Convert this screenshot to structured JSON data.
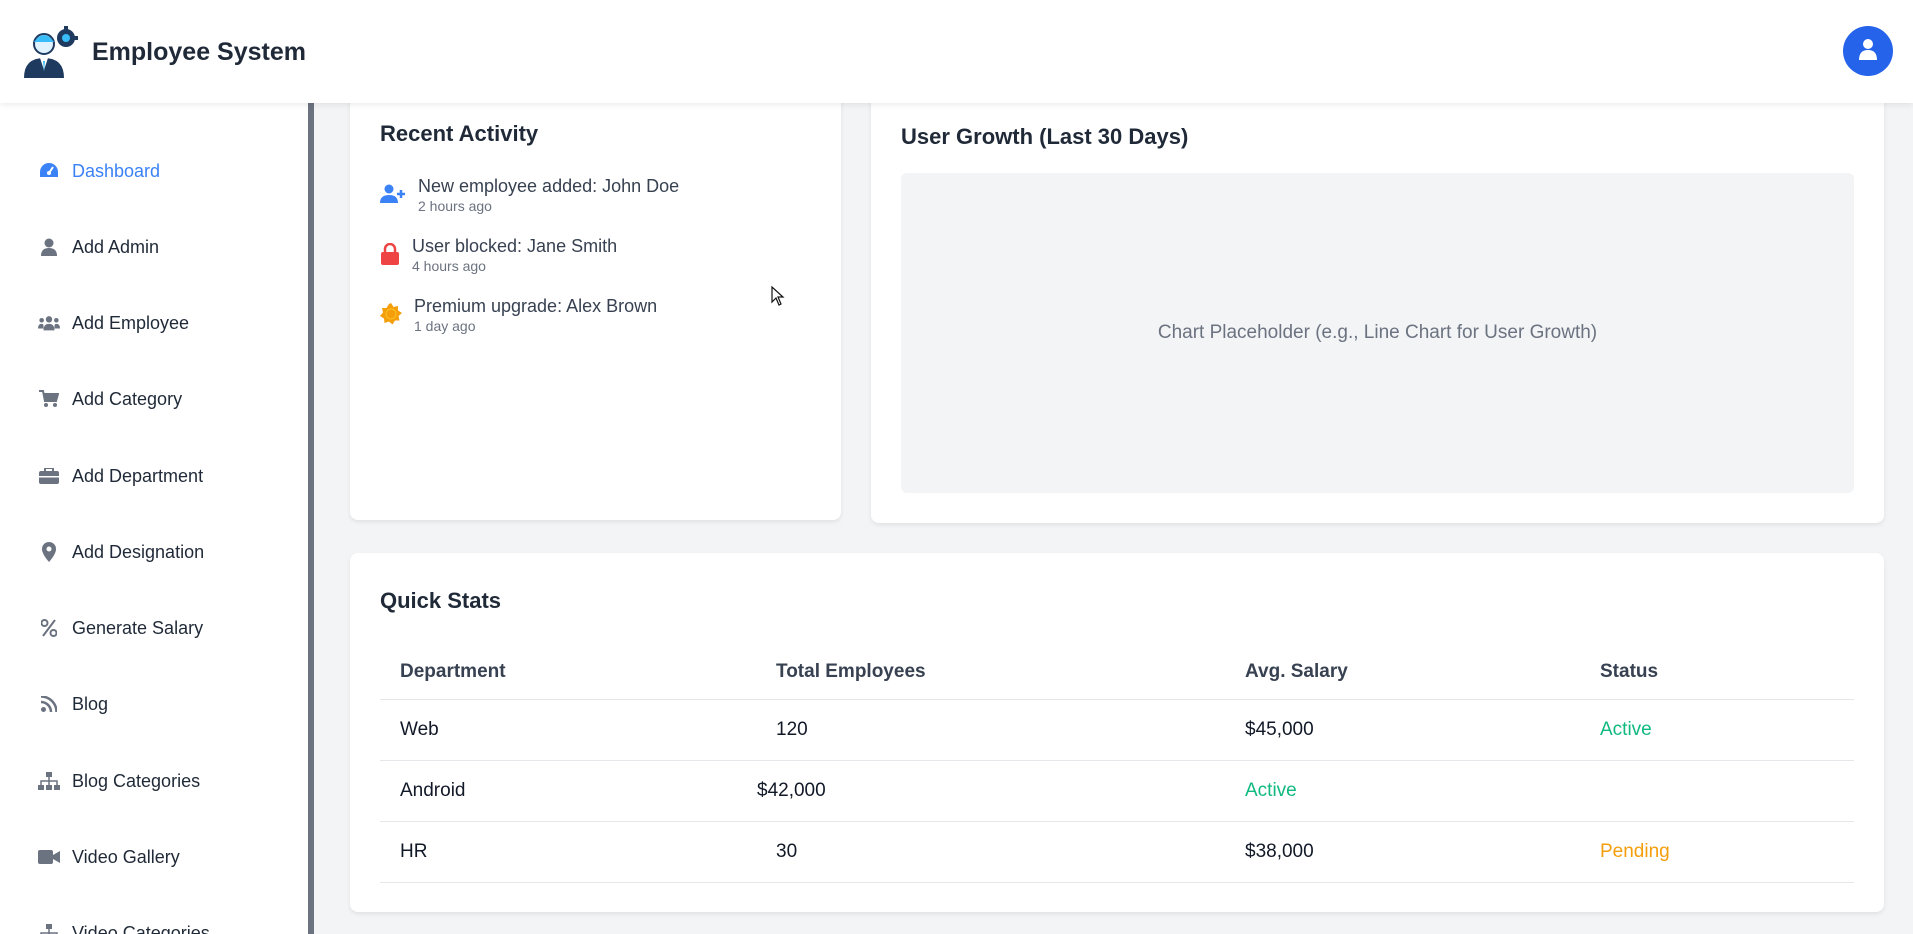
{
  "header": {
    "title": "Employee System",
    "logo_icon": "employee-gear-logo-icon",
    "user_icon": "user-icon"
  },
  "sidebar": {
    "items": [
      {
        "label": "Dashboard",
        "icon": "tachometer-icon",
        "active": true
      },
      {
        "label": "Add Admin",
        "icon": "user-icon"
      },
      {
        "label": "Add Employee",
        "icon": "users-icon"
      },
      {
        "label": "Add Category",
        "icon": "cart-icon"
      },
      {
        "label": "Add Department",
        "icon": "briefcase-icon"
      },
      {
        "label": "Add Designation",
        "icon": "map-pin-icon"
      },
      {
        "label": "Generate Salary",
        "icon": "percent-icon"
      },
      {
        "label": "Blog",
        "icon": "rss-icon"
      },
      {
        "label": "Blog Categories",
        "icon": "sitemap-icon"
      },
      {
        "label": "Video Gallery",
        "icon": "video-icon"
      },
      {
        "label": "Video Categories",
        "icon": "sitemap-icon"
      }
    ]
  },
  "recent_activity": {
    "title": "Recent Activity",
    "items": [
      {
        "text": "New employee added: John Doe",
        "time": "2 hours ago",
        "icon": "user-plus-icon"
      },
      {
        "text": "User blocked: Jane Smith",
        "time": "4 hours ago",
        "icon": "lock-icon"
      },
      {
        "text": "Premium upgrade: Alex Brown",
        "time": "1 day ago",
        "icon": "badge-icon"
      }
    ]
  },
  "user_growth": {
    "title": "User Growth (Last 30 Days)",
    "placeholder": "Chart Placeholder (e.g., Line Chart for User Growth)"
  },
  "quick_stats": {
    "title": "Quick Stats",
    "headers": [
      "Department",
      "Total Employees",
      "Avg. Salary",
      "Status"
    ],
    "rows": [
      {
        "department": "Web",
        "total": "120",
        "salary": "$45,000",
        "status": "Active"
      },
      {
        "department": "Android",
        "total": "",
        "salary": "$42,000",
        "status": "Active"
      },
      {
        "department": "HR",
        "total": "30",
        "salary": "$38,000",
        "status": "Pending"
      }
    ]
  },
  "colors": {
    "accent": "#3b82f6",
    "user_button": "#2563eb",
    "active": "#10b981",
    "pending": "#f59e0b",
    "lock": "#ef4444"
  }
}
